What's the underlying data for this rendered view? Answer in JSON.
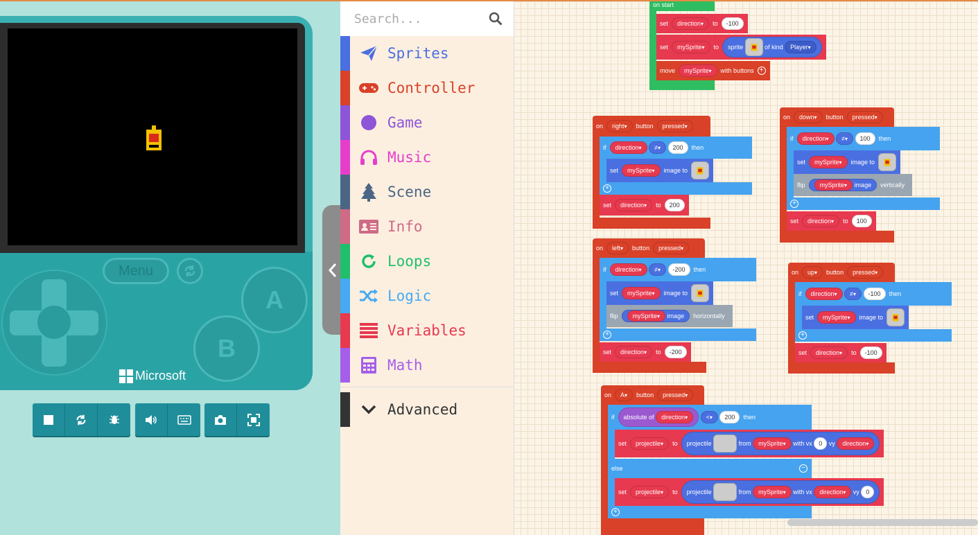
{
  "simulator": {
    "menu_label": "Menu",
    "btn_a": "A",
    "btn_b": "B",
    "brand": "Microsoft",
    "toolbar_icons": [
      "stop-icon",
      "restart-icon",
      "debug-icon",
      "sound-icon",
      "keyboard-icon",
      "screenshot-icon",
      "fullscreen-icon"
    ]
  },
  "search": {
    "placeholder": "Search..."
  },
  "categories": [
    {
      "label": "Sprites",
      "color": "#4a6fe0",
      "icon": "paper-plane-icon"
    },
    {
      "label": "Controller",
      "color": "#d94128",
      "icon": "gamepad-icon"
    },
    {
      "label": "Game",
      "color": "#8e55d8",
      "icon": "circle-icon"
    },
    {
      "label": "Music",
      "color": "#e63ecb",
      "icon": "headphones-icon"
    },
    {
      "label": "Scene",
      "color": "#4b6584",
      "icon": "tree-icon"
    },
    {
      "label": "Info",
      "color": "#cf6a87",
      "icon": "id-card-icon"
    },
    {
      "label": "Loops",
      "color": "#20bf6b",
      "icon": "loop-icon"
    },
    {
      "label": "Logic",
      "color": "#45aaf2",
      "icon": "shuffle-icon"
    },
    {
      "label": "Variables",
      "color": "#e7394f",
      "icon": "list-icon"
    },
    {
      "label": "Math",
      "color": "#a55eea",
      "icon": "calculator-icon"
    }
  ],
  "advanced": {
    "label": "Advanced",
    "color": "#333333"
  },
  "blocks": {
    "on_start": "on start",
    "set": "set",
    "to": "to",
    "direction": "direction",
    "mySprite": "mySprite",
    "sprite": "sprite",
    "of_kind": "of kind",
    "Player": "Player",
    "move": "move",
    "with_buttons": "with buttons",
    "on": "on",
    "button": "button",
    "pressed": "pressed",
    "if": "if",
    "then": "then",
    "else": "else",
    "neq": "≠",
    "lt": "<",
    "image_to": "image to",
    "flip": "flip",
    "image": "image",
    "vertically": "vertically",
    "horizontally": "horizontally",
    "right": "right",
    "down": "down",
    "left": "left",
    "up": "up",
    "A": "A",
    "absolute_of": "absolute of",
    "projectile": "projectile",
    "from": "from",
    "with_vx": "with vx",
    "vy": "vy",
    "n_m100": "-100",
    "n_200": "200",
    "n_100": "100",
    "n_m200": "-200",
    "n_0": "0"
  }
}
